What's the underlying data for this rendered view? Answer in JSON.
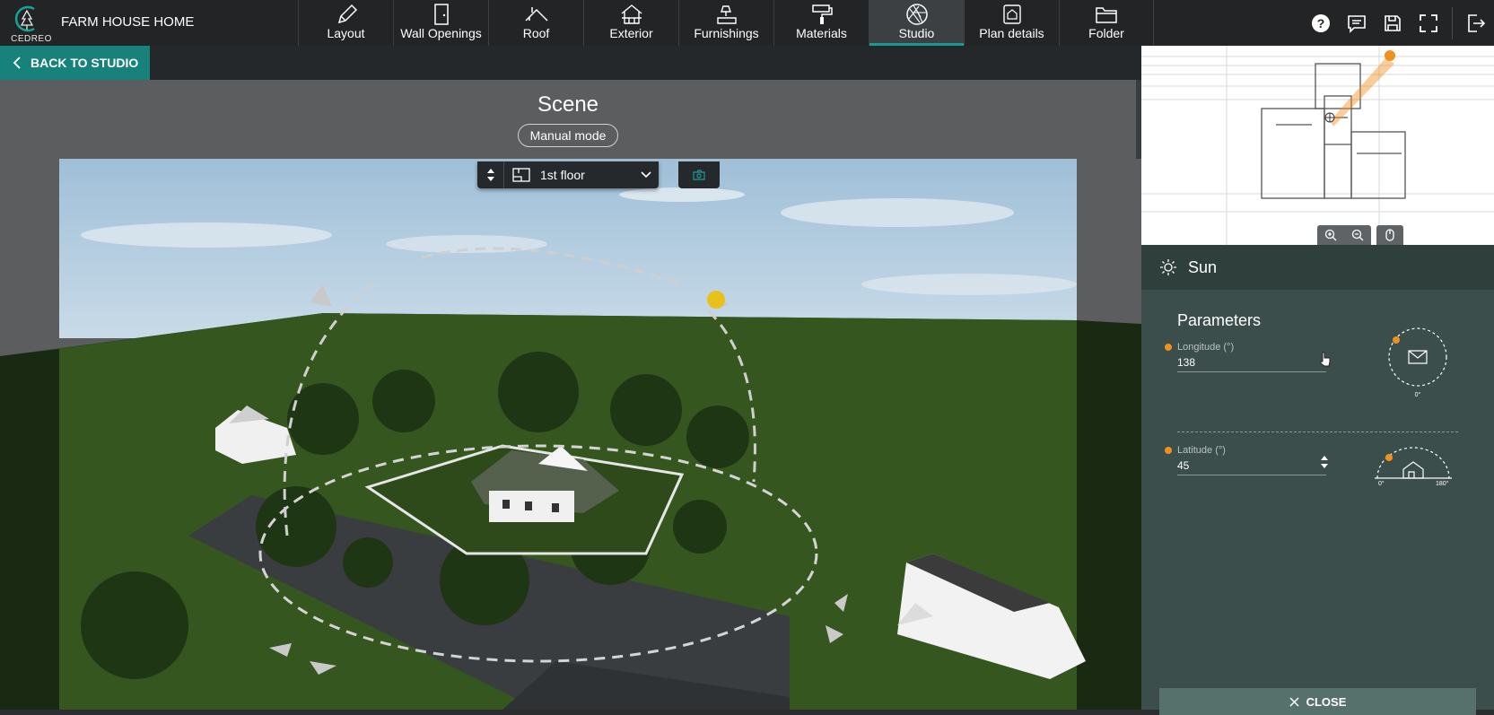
{
  "app": {
    "logo_text": "CEDREO",
    "project_title": "FARM HOUSE HOME"
  },
  "nav": {
    "items": [
      {
        "label": "Layout",
        "icon": "pencil-icon"
      },
      {
        "label": "Wall Openings",
        "icon": "door-icon"
      },
      {
        "label": "Roof",
        "icon": "roof-icon"
      },
      {
        "label": "Exterior",
        "icon": "house-icon"
      },
      {
        "label": "Furnishings",
        "icon": "lamp-icon"
      },
      {
        "label": "Materials",
        "icon": "paint-roller-icon"
      },
      {
        "label": "Studio",
        "icon": "aperture-icon",
        "active": true
      },
      {
        "label": "Plan details",
        "icon": "tag-icon"
      },
      {
        "label": "Folder",
        "icon": "folder-icon"
      }
    ]
  },
  "tools": [
    "help-icon",
    "comment-icon",
    "save-icon",
    "fullscreen-icon",
    "exit-icon"
  ],
  "viewport": {
    "back_label": "BACK TO STUDIO",
    "scene_title": "Scene",
    "mode_label": "Manual mode",
    "floor_value": "1st floor"
  },
  "panel": {
    "section_title": "Sun",
    "params_title": "Parameters",
    "longitude": {
      "label": "Longitude (°)",
      "value": "138",
      "dial_label": "0°"
    },
    "latitude": {
      "label": "Latitude (°)",
      "value": "45",
      "dial_min": "0°",
      "dial_max": "180°"
    },
    "close_label": "CLOSE"
  },
  "colors": {
    "accent": "#16827b",
    "sun": "#f0901e",
    "panel": "#3b4e4b"
  }
}
